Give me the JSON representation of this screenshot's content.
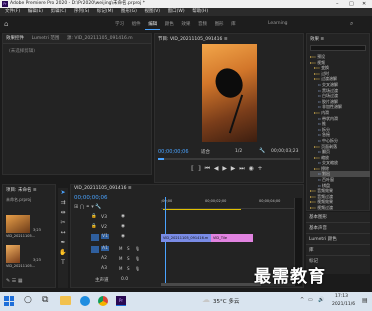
{
  "titlebar": {
    "title": "Adobe Premiere Pro 2020 - D:\\Pr2020\\weijing\\未命名.prproj *",
    "controls": [
      "–",
      "□",
      "✕"
    ]
  },
  "menubar": {
    "items": [
      "文件(F)",
      "编辑(E)",
      "剪辑(C)",
      "序列(S)",
      "标记(M)",
      "图形(G)",
      "视图(V)",
      "窗口(W)",
      "帮助(H)"
    ]
  },
  "workspaces": {
    "tabs": [
      "学习",
      "组件",
      "编辑",
      "颜色",
      "效果",
      "音频",
      "图形",
      "库"
    ],
    "right": "Learning"
  },
  "source_panel": {
    "tabs": [
      "效果控件",
      "Lumetri 范围",
      "源: VID_20211105_091416.m"
    ],
    "empty_text": "(未选择剪辑)"
  },
  "program_monitor": {
    "title": "节目: VID_20211105_091416 ≡",
    "timecode": "00;00;00;06",
    "fit": "适合",
    "quality": "1/2",
    "duration": "00;00;03;23"
  },
  "effects_panel": {
    "header": "效果 ≡",
    "search": "",
    "items": [
      "预设",
      "视频",
      "变换",
      "过时",
      "过渡溶解",
      "交叉溶解",
      "黑场过渡",
      "白场过渡",
      "胶片溶解",
      "非加性溶解",
      "内滑",
      "带状内滑",
      "推",
      "拆分",
      "急摇",
      "中心拆分",
      "页面剥落",
      "翻页",
      "缩放",
      "交叉缩放",
      "擦除",
      "划出",
      "百叶窗",
      "棋盘",
      "音频效果",
      "音频过渡",
      "视频效果",
      "视频过渡"
    ]
  },
  "side_panels": [
    "基本图形",
    "基本声音",
    "Lumetri 颜色",
    "库",
    "标记"
  ],
  "project_panel": {
    "title": "项目: 未命名 ≡",
    "file": "未命名.prproj",
    "clips": [
      {
        "name": "VID_20211105...",
        "duration": "3;23"
      },
      {
        "name": "VID_20211105...",
        "duration": "3;23"
      }
    ]
  },
  "timeline": {
    "title": "VID_20211105_091416 ≡",
    "timecode": "00;00;00;06",
    "ruler": [
      ";00;00",
      "00;00;02;00",
      "00;00;04;00"
    ],
    "video_tracks": [
      "V3",
      "V2",
      "V1"
    ],
    "audio_tracks": [
      "A1",
      "A2",
      "A3"
    ],
    "master": "主声道",
    "master_value": "0.0",
    "clip_v": "VID_20211105_091416.m",
    "clip_v2": "VID_Tile"
  },
  "taskbar": {
    "weather": "35°C 多云",
    "time": "17:13",
    "date": "2021/11/6"
  },
  "watermark": "最需教育"
}
